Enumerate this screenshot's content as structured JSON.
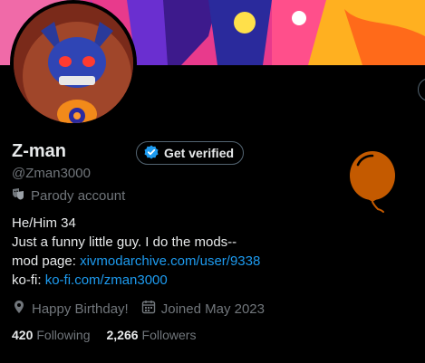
{
  "profile": {
    "display_name": "Z-man",
    "handle": "@Zman3000",
    "verify_label": "Get verified",
    "parody_label": "Parody account",
    "bio": {
      "line1": "He/Him 34",
      "line2": "Just a funny little guy. I do the mods--",
      "modpage_prefix": "mod page: ",
      "modpage_link": "xivmodarchive.com/user/9338",
      "kofi_prefix": "ko-fi: ",
      "kofi_link": "ko-fi.com/zman3000"
    },
    "birthday": "Happy Birthday!",
    "joined": "Joined May 2023",
    "following_count": "420",
    "following_label": "Following",
    "followers_count": "2,266",
    "followers_label": "Followers"
  },
  "icons": {
    "verified": "verified-badge-icon",
    "parody": "theater-masks-icon",
    "location": "location-pin-icon",
    "calendar": "calendar-icon",
    "balloon": "birthday-balloon-icon"
  },
  "colors": {
    "background": "#000000",
    "link": "#1d9bf0",
    "muted": "#71767b",
    "balloon": "#c45a00"
  }
}
